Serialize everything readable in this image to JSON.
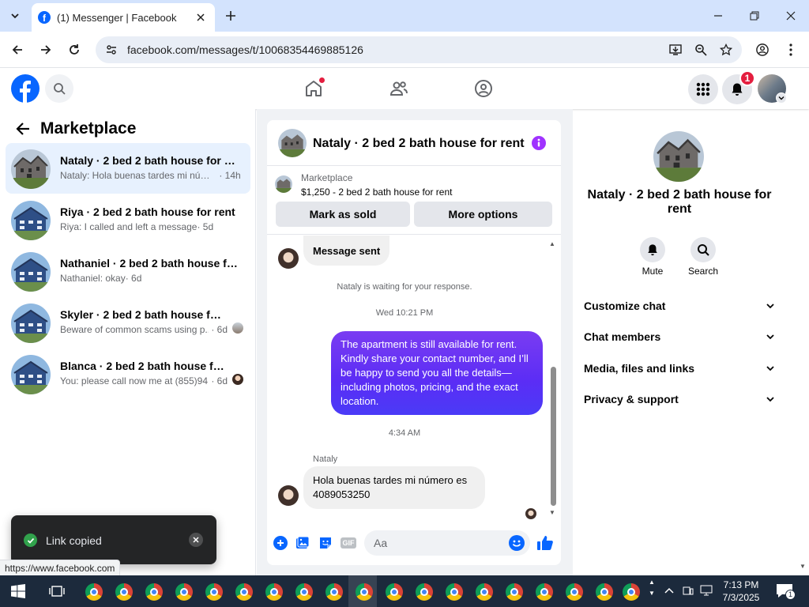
{
  "browser": {
    "tab_title": "(1) Messenger | Facebook",
    "url": "facebook.com/messages/t/10068354469885126",
    "status_url": "https://www.facebook.com"
  },
  "header": {
    "notification_count": "1"
  },
  "left_panel": {
    "title": "Marketplace",
    "conversations": [
      {
        "name": "Nataly · 2 bed 2 bath house for rent",
        "preview": "Nataly: Hola buenas tardes mi núme...",
        "time": "· 14h",
        "active": true
      },
      {
        "name": "Riya · 2 bed 2 bath house for rent",
        "preview": "Riya: I called and left a message",
        "time": "· 5d"
      },
      {
        "name": "Nathaniel · 2 bed 2 bath house for...",
        "preview": "Nathaniel: okay",
        "time": "· 6d"
      },
      {
        "name": "Skyler · 2 bed 2 bath house for r...",
        "preview": "Beware of common scams using p...",
        "time": "· 6d"
      },
      {
        "name": "Blanca · 2 bed 2 bath house for ...",
        "preview": "You: please call now me at (855)94...",
        "time": "· 6d"
      }
    ]
  },
  "chat": {
    "title": "Nataly · 2 bed 2 bath house for rent",
    "listing_source": "Marketplace",
    "listing_desc": "$1,250 - 2 bed 2 bath house for rent",
    "mark_sold_label": "Mark as sold",
    "more_options_label": "More options",
    "message_sent": "Message sent",
    "waiting_note": "Nataly is waiting for your response.",
    "timestamp_1": "Wed 10:21 PM",
    "outgoing_message": "The apartment is still available for rent. Kindly share your contact number, and I’ll be happy to send you all the details—including photos, pricing, and the exact location.",
    "timestamp_2": "4:34 AM",
    "sender_name": "Nataly",
    "incoming_message": "Hola buenas tardes mi número es 4089053250",
    "composer_placeholder": "Aa"
  },
  "right_panel": {
    "name": "Nataly · 2 bed 2 bath house for rent",
    "mute_label": "Mute",
    "search_label": "Search",
    "sections": [
      "Customize chat",
      "Chat members",
      "Media, files and links",
      "Privacy & support"
    ]
  },
  "toast": {
    "text": "Link copied"
  },
  "taskbar": {
    "time": "7:13 PM",
    "date": "7/3/2025",
    "notif_count": "1"
  },
  "colors": {
    "fb_blue": "#0866ff",
    "messenger_purple": "#a033ff",
    "active_conv": "#e7f1fe"
  }
}
